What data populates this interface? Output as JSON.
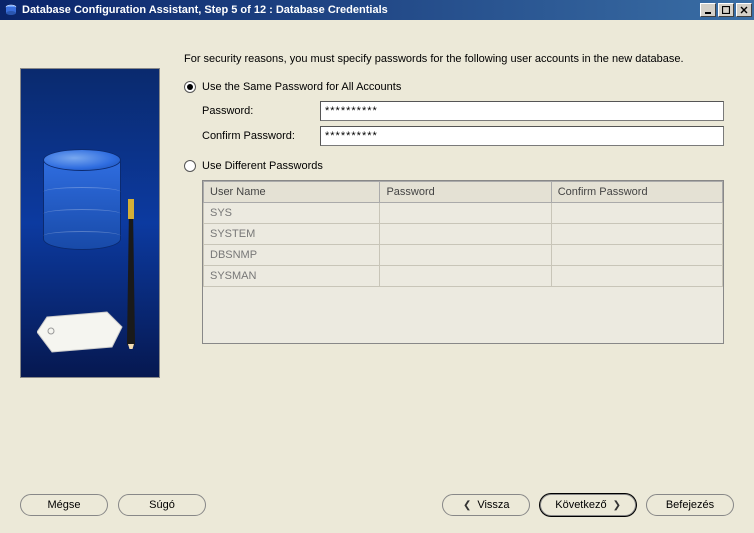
{
  "window": {
    "title": "Database Configuration Assistant, Step 5 of 12 : Database Credentials"
  },
  "intro": "For security reasons, you must specify passwords for the following user accounts in the new database.",
  "options": {
    "same_label": "Use the Same Password for All Accounts",
    "diff_label": "Use Different Passwords",
    "selected": "same"
  },
  "fields": {
    "password_label": "Password:",
    "confirm_label": "Confirm Password:",
    "password_value": "**********",
    "confirm_value": "**********"
  },
  "table": {
    "headers": {
      "user": "User Name",
      "password": "Password",
      "confirm": "Confirm Password"
    },
    "rows": [
      {
        "user": "SYS",
        "password": "",
        "confirm": ""
      },
      {
        "user": "SYSTEM",
        "password": "",
        "confirm": ""
      },
      {
        "user": "DBSNMP",
        "password": "",
        "confirm": ""
      },
      {
        "user": "SYSMAN",
        "password": "",
        "confirm": ""
      }
    ]
  },
  "buttons": {
    "cancel": "Mégse",
    "help": "Súgó",
    "back": "Vissza",
    "next": "Következő",
    "finish": "Befejezés"
  }
}
